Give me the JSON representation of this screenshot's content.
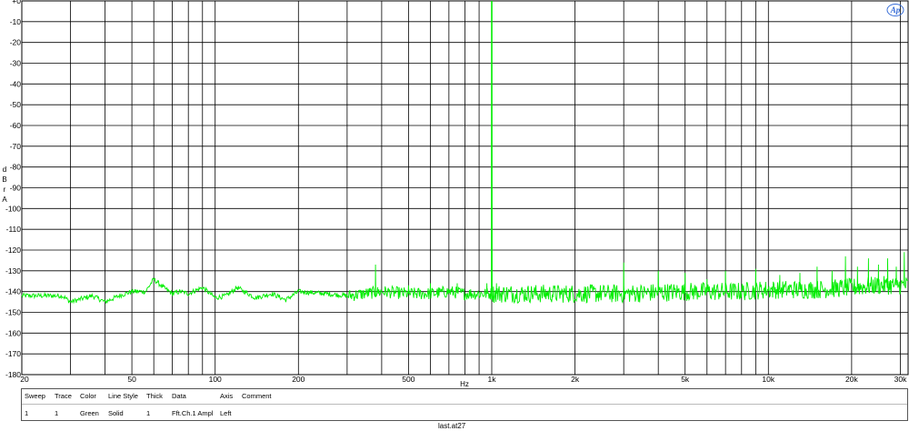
{
  "chart_data": {
    "type": "line",
    "xscale": "log",
    "xlim": [
      20,
      32000
    ],
    "ylim": [
      -180,
      0
    ],
    "xlabel": "Hz",
    "ylabel": "d B r A",
    "grid": true,
    "y_ticks": [
      "+0",
      "-10",
      "-20",
      "-30",
      "-40",
      "-50",
      "-60",
      "-70",
      "-80",
      "-90",
      "-100",
      "-110",
      "-120",
      "-130",
      "-140",
      "-150",
      "-160",
      "-170",
      "-180"
    ],
    "x_ticks": [
      {
        "v": 20,
        "label": "20"
      },
      {
        "v": 50,
        "label": "50"
      },
      {
        "v": 100,
        "label": "100"
      },
      {
        "v": 200,
        "label": "200"
      },
      {
        "v": 500,
        "label": "500"
      },
      {
        "v": 1000,
        "label": "1k"
      },
      {
        "v": 2000,
        "label": "2k"
      },
      {
        "v": 5000,
        "label": "5k"
      },
      {
        "v": 10000,
        "label": "10k"
      },
      {
        "v": 20000,
        "label": "20k"
      },
      {
        "v": 30000,
        "label": "30k"
      }
    ],
    "x_gridlines": [
      20,
      30,
      40,
      50,
      60,
      70,
      80,
      90,
      100,
      200,
      300,
      400,
      500,
      600,
      700,
      800,
      900,
      1000,
      2000,
      3000,
      4000,
      5000,
      6000,
      7000,
      8000,
      9000,
      10000,
      20000,
      30000
    ],
    "series": [
      {
        "color": "#00ee00",
        "noise_floor": [
          [
            20,
            -142
          ],
          [
            28,
            -142
          ],
          [
            30,
            -145
          ],
          [
            36,
            -142
          ],
          [
            40,
            -145
          ],
          [
            45,
            -142
          ],
          [
            50,
            -140
          ],
          [
            56,
            -140
          ],
          [
            60,
            -134
          ],
          [
            65,
            -138
          ],
          [
            70,
            -141
          ],
          [
            75,
            -140
          ],
          [
            80,
            -141
          ],
          [
            90,
            -138
          ],
          [
            100,
            -143
          ],
          [
            110,
            -142
          ],
          [
            120,
            -138
          ],
          [
            140,
            -143
          ],
          [
            160,
            -141
          ],
          [
            180,
            -144
          ],
          [
            200,
            -140
          ],
          [
            250,
            -141
          ],
          [
            300,
            -142
          ],
          [
            350,
            -141
          ],
          [
            400,
            -140
          ],
          [
            500,
            -141
          ],
          [
            600,
            -141
          ],
          [
            700,
            -140
          ],
          [
            800,
            -141
          ],
          [
            900,
            -141
          ],
          [
            1000,
            -141
          ],
          [
            2000,
            -141
          ],
          [
            3000,
            -141
          ],
          [
            5000,
            -140
          ],
          [
            8000,
            -140
          ],
          [
            10000,
            -139
          ],
          [
            15000,
            -139
          ],
          [
            20000,
            -138
          ],
          [
            25000,
            -137
          ],
          [
            32000,
            -137
          ]
        ],
        "peaks": [
          [
            1000,
            0
          ],
          [
            380,
            -127
          ],
          [
            500,
            -137
          ],
          [
            600,
            -136
          ],
          [
            750,
            -136
          ],
          [
            960,
            -136
          ],
          [
            1040,
            -136
          ],
          [
            3000,
            -126
          ],
          [
            4000,
            -130
          ],
          [
            5000,
            -131
          ],
          [
            6000,
            -134
          ],
          [
            7000,
            -130
          ],
          [
            9000,
            -129
          ],
          [
            11000,
            -132
          ],
          [
            13000,
            -131
          ],
          [
            15000,
            -128
          ],
          [
            17000,
            -130
          ],
          [
            19000,
            -123
          ],
          [
            21000,
            -128
          ],
          [
            23000,
            -124
          ],
          [
            25000,
            -127
          ],
          [
            27000,
            -124
          ],
          [
            29000,
            -128
          ],
          [
            31000,
            -121
          ]
        ]
      }
    ]
  },
  "legend": {
    "headers": [
      "Sweep",
      "Trace",
      "Color",
      "Line Style",
      "Thick",
      "Data",
      "Axis",
      "Comment"
    ],
    "row": [
      "1",
      "1",
      "Green",
      "Solid",
      "1",
      "Fft.Ch.1 Ampl",
      "Left",
      ""
    ]
  },
  "filename": "last.at27",
  "logo_text": "Ap"
}
